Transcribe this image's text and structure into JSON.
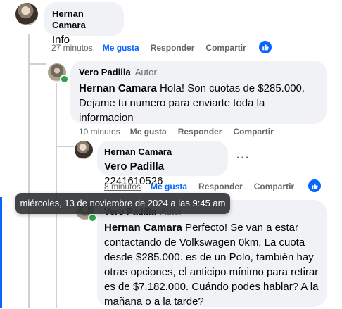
{
  "comment1": {
    "author": "Hernan Camara",
    "text": "Info",
    "time": "27 minutos",
    "like_label": "Me gusta",
    "reply_label": "Responder",
    "share_label": "Compartir"
  },
  "reply1": {
    "author": "Vero Padilla",
    "author_tag": "Autor",
    "mention": "Hernan Camara",
    "text": " Hola! Son cuotas de $285.000. Dejame tu numero para enviarte toda la informacion",
    "time": "10 minutos",
    "like_label": "Me gusta",
    "reply_label": "Responder",
    "share_label": "Compartir"
  },
  "reply2": {
    "author": "Hernan Camara",
    "mention": "Vero Padilla",
    "text": " 2241610526",
    "time": "8 minutos",
    "like_label": "Me gusta",
    "reply_label": "Responder",
    "share_label": "Compartir",
    "more": "···"
  },
  "reply3": {
    "author": "Vero Padilla",
    "author_tag": "Autor",
    "mention": "Hernan Camara",
    "text": " Perfecto! Se van a estar contactando de Volkswagen 0km, La cuota desde $285.000. es de un Polo, también hay otras opciones, el anticipo mínimo para retirar es de $7.182.000. Cuándo podes hablar? A la mañana o a la tarde?"
  },
  "tooltip": "miércoles, 13 de noviembre de 2024 a las 9:45 am",
  "colors": {
    "accent": "#0866ff",
    "bubble": "#f0f2f5",
    "meta": "#65676b",
    "online": "#31a24c"
  }
}
